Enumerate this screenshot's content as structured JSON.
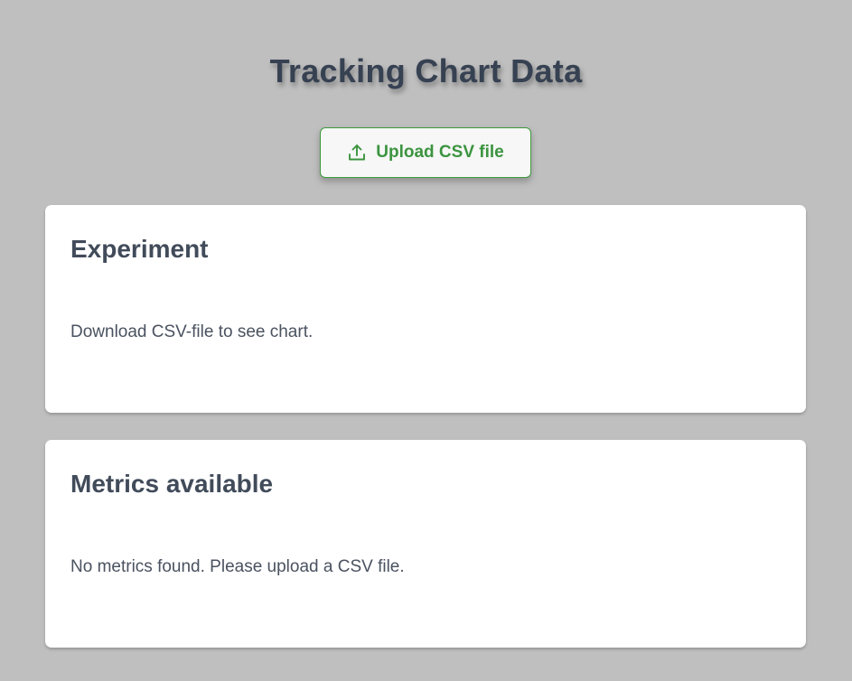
{
  "header": {
    "title": "Tracking Chart Data"
  },
  "upload": {
    "label": "Upload CSV file",
    "icon": "upload-icon",
    "color": "#3c9440"
  },
  "experiment": {
    "title": "Experiment",
    "message": "Download CSV-file to see chart."
  },
  "metrics": {
    "title": "Metrics available",
    "message": "No metrics found. Please upload a CSV file."
  }
}
